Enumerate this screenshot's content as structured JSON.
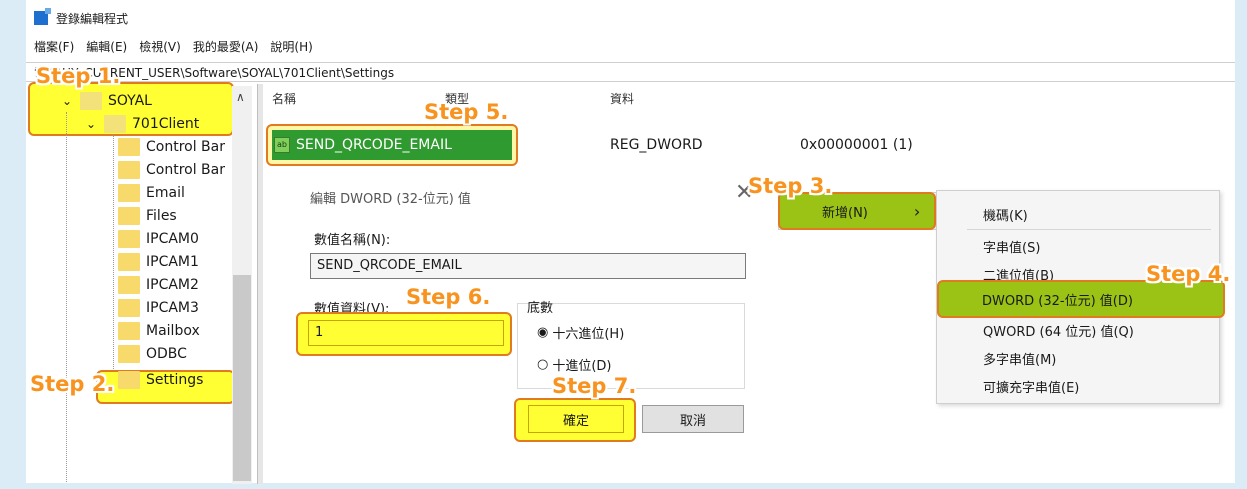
{
  "window": {
    "title": "登錄編輯程式"
  },
  "menu": [
    "檔案(F)",
    "編輯(E)",
    "檢視(V)",
    "我的最愛(A)",
    "說明(H)"
  ],
  "address": {
    "prefix": "電腦\\H",
    "path": "Y_CURRENT_USER\\Software\\SOYAL\\701Client\\Settings"
  },
  "tree": {
    "soyal": "SOYAL",
    "client": "701Client",
    "children": [
      "Control Bar",
      "Control Bar",
      "Email",
      "Files",
      "IPCAM0",
      "IPCAM1",
      "IPCAM2",
      "IPCAM3",
      "Mailbox",
      "ODBC",
      "Settings"
    ]
  },
  "columns": {
    "name": "名稱",
    "type": "類型",
    "data": "資料"
  },
  "value_row": {
    "icon": "ab",
    "name": "SEND_QRCODE_EMAIL",
    "type": "REG_DWORD",
    "data": "0x00000001 (1)"
  },
  "dialog": {
    "title": "編輯 DWORD (32-位元) 值",
    "name_label": "數值名稱(N):",
    "name_value": "SEND_QRCODE_EMAIL",
    "data_label": "數值資料(V):",
    "data_value": "1",
    "base_label": "底數",
    "hex_label": "十六進位(H)",
    "dec_label": "十進位(D)",
    "ok_label": "確定",
    "cancel_label": "取消",
    "hex_selected": true
  },
  "context_menu": {
    "new_label": "新增(N)",
    "arrow": "›"
  },
  "submenu": {
    "items": [
      "機碼(K)",
      "字串值(S)",
      "二進位值(B)",
      "DWORD (32-位元) 值(D)",
      "QWORD (64 位元) 值(Q)",
      "多字串值(M)",
      "可擴充字串值(E)"
    ]
  },
  "steps": [
    "Step 1.",
    "Step 2.",
    "Step 3.",
    "Step 4.",
    "Step 5.",
    "Step 6.",
    "Step 7."
  ],
  "colors": {
    "highlight_yellow": "#ffff33",
    "highlight_green": "#9bc316",
    "step_orange": "#f7931e",
    "frame_blue": "#dcecf7"
  }
}
